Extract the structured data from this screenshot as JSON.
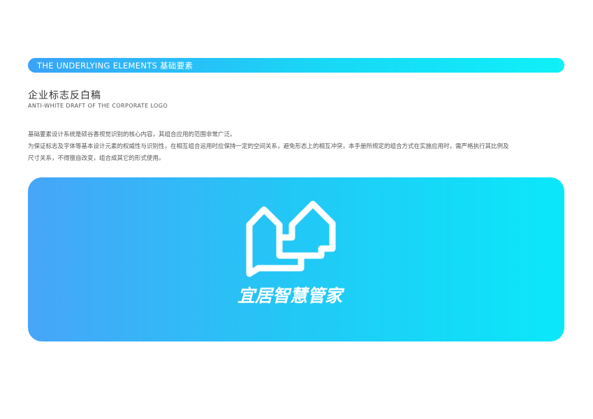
{
  "header": {
    "label": "THE UNDERLYING ELEMENTS 基础要素"
  },
  "section": {
    "title": "企业标志反白稿",
    "subtitle": "ANTI-WHITE DRAFT OF THE CORPORATE LOGO"
  },
  "description": {
    "line1": "基础要素设计系统是硕谷香视觉识别的核心内容，其组合应用的范围非常广泛。",
    "line2": "为保证标志及字体等基本设计元素的权威性与识别性，在相互组合运用时应保持一定的空间关系，避免形态上的相互冲突，本手册所规定的组合方式在实施应用时，需严格执行其比例及",
    "line3": "尺寸关系，不得擅自改变，组合成其它的形式使用。"
  },
  "logo": {
    "icon": "two-houses-speech-bubble-icon",
    "brand_name": "宜居智慧管家"
  },
  "colors": {
    "accent_start": "#3aa3f8",
    "accent_end": "#0ff0f8",
    "logo_fill": "#ffffff"
  }
}
